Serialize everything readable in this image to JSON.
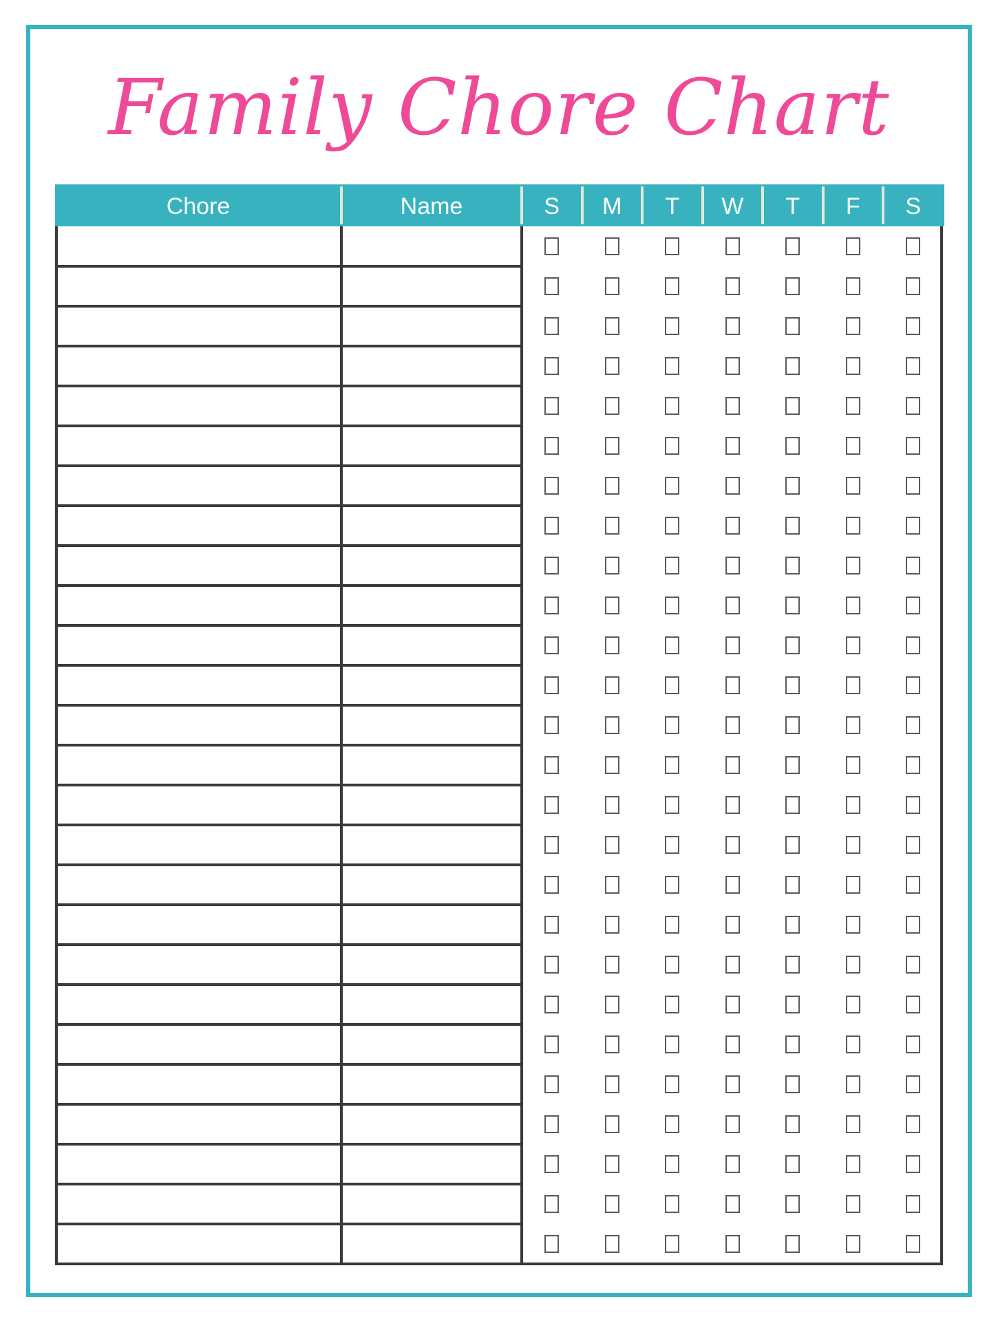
{
  "title": "Family Chore Chart",
  "colors": {
    "accent": "#38b2bf",
    "title": "#ee4a98",
    "rule": "#3a3a3a",
    "header_divider": "#e2e8d6"
  },
  "table": {
    "headers": {
      "chore": "Chore",
      "name": "Name"
    },
    "days": [
      "S",
      "M",
      "T",
      "W",
      "T",
      "F",
      "S"
    ],
    "row_count": 26,
    "rows_checked": []
  }
}
